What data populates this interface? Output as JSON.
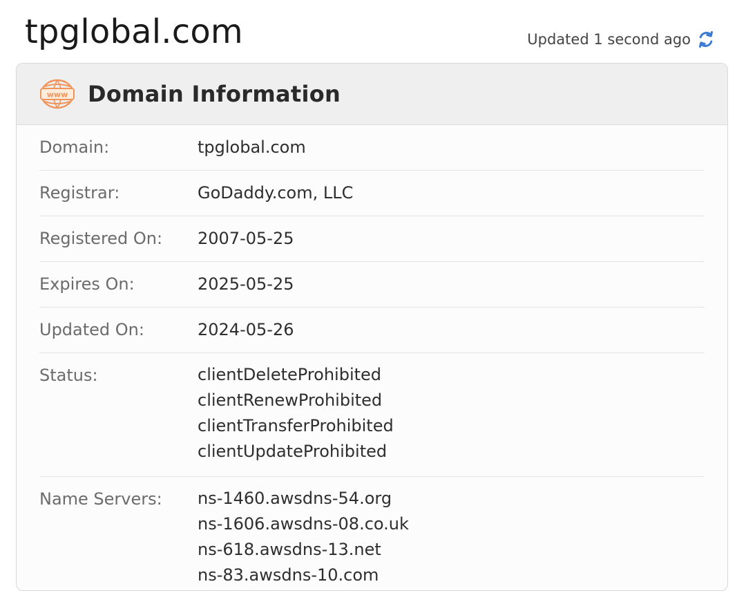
{
  "header": {
    "domain": "tpglobal.com",
    "updated_text": "Updated 1 second ago",
    "refresh_icon": "refresh-icon",
    "accent_color": "#3a7bd5"
  },
  "card": {
    "icon": "www-globe-icon",
    "icon_color": "#f0945a",
    "title": "Domain Information"
  },
  "fields": {
    "domain": {
      "label": "Domain:",
      "value": "tpglobal.com"
    },
    "registrar": {
      "label": "Registrar:",
      "value": "GoDaddy.com, LLC"
    },
    "registered_on": {
      "label": "Registered On:",
      "value": "2007-05-25"
    },
    "expires_on": {
      "label": "Expires On:",
      "value": "2025-05-25"
    },
    "updated_on": {
      "label": "Updated On:",
      "value": "2024-05-26"
    },
    "status": {
      "label": "Status:",
      "values": [
        "clientDeleteProhibited",
        "clientRenewProhibited",
        "clientTransferProhibited",
        "clientUpdateProhibited"
      ]
    },
    "name_servers": {
      "label": "Name Servers:",
      "values": [
        "ns-1460.awsdns-54.org",
        "ns-1606.awsdns-08.co.uk",
        "ns-618.awsdns-13.net",
        "ns-83.awsdns-10.com"
      ]
    }
  }
}
